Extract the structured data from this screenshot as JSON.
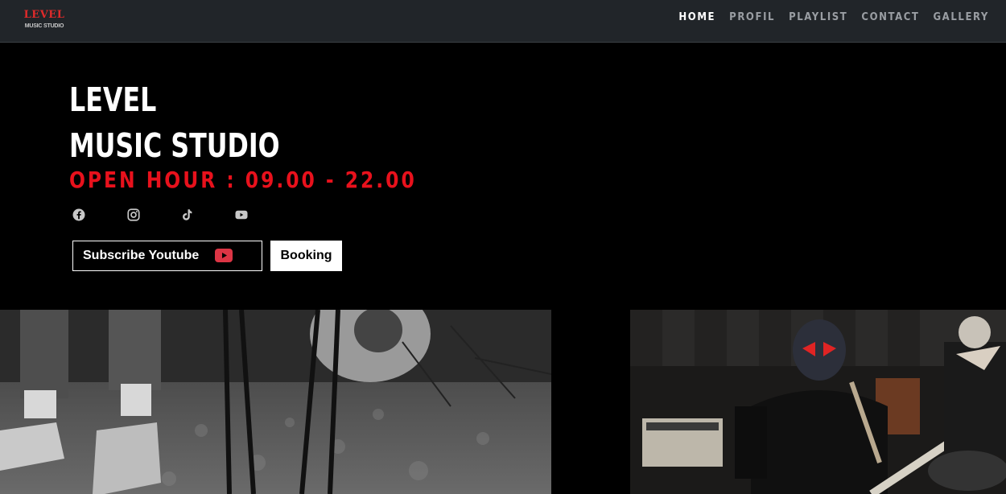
{
  "navbar": {
    "logo": {
      "top_text": "LEVEL",
      "bottom_text": "MUSIC STUDIO"
    },
    "links": [
      {
        "label": "HOME",
        "active": true
      },
      {
        "label": "PROFIL",
        "active": false
      },
      {
        "label": "PLAYLIST",
        "active": false
      },
      {
        "label": "CONTACT",
        "active": false
      },
      {
        "label": "GALLERY",
        "active": false
      }
    ]
  },
  "hero": {
    "title_line1": "LEVEL",
    "title_line2": "MUSIC STUDIO",
    "open_hour": "OPEN HOUR : 09.00 - 22.00",
    "socials": [
      "facebook-icon",
      "instagram-icon",
      "tiktok-icon",
      "youtube-icon"
    ],
    "subscribe_label": "Subscribe Youtube",
    "booking_label": "Booking"
  },
  "colors": {
    "navbar_bg": "#212529",
    "accent_red": "#e8111c",
    "nav_active": "#ffffff",
    "nav_inactive": "#9a9ea3",
    "youtube_red": "#dc3545"
  },
  "gallery": {
    "left_photo": "drummer-floor-photo",
    "right_photo": "masked-band-photo"
  }
}
